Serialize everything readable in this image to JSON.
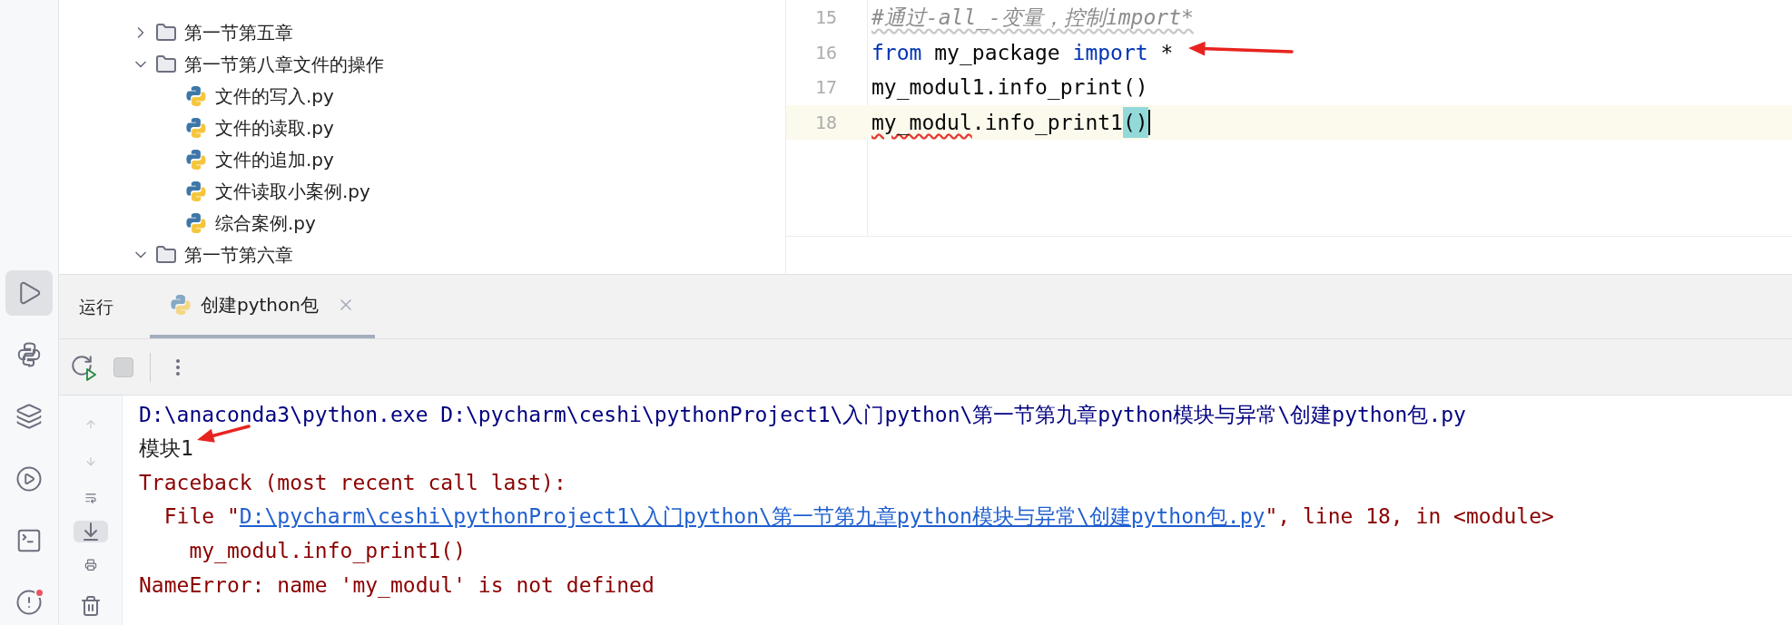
{
  "project_tree": {
    "items": [
      {
        "label": "第一节第五章",
        "kind": "folder",
        "expanded": false
      },
      {
        "label": "第一节第八章文件的操作",
        "kind": "folder",
        "expanded": true,
        "children": [
          {
            "label": "文件的写入.py",
            "kind": "file"
          },
          {
            "label": "文件的读取.py",
            "kind": "file"
          },
          {
            "label": "文件的追加.py",
            "kind": "file"
          },
          {
            "label": "文件读取小案例.py",
            "kind": "file"
          },
          {
            "label": "综合案例.py",
            "kind": "file"
          }
        ]
      },
      {
        "label": "第一节第六章",
        "kind": "folder",
        "expanded": true
      }
    ]
  },
  "editor": {
    "lines": [
      {
        "number": "15",
        "current": false,
        "tokens": [
          {
            "text": "#通过-all_-变量，控制import*",
            "kind": "comment"
          }
        ]
      },
      {
        "number": "16",
        "current": false,
        "tokens": [
          {
            "text": "from",
            "kind": "keyword"
          },
          {
            "text": " my_package ",
            "kind": "plain"
          },
          {
            "text": "import",
            "kind": "keyword"
          },
          {
            "text": " *",
            "kind": "plain"
          }
        ]
      },
      {
        "number": "17",
        "current": false,
        "tokens": [
          {
            "text": "my_modul1.info_print()",
            "kind": "plain"
          }
        ]
      },
      {
        "number": "18",
        "current": true,
        "tokens": [
          {
            "text": "my_modul",
            "kind": "error"
          },
          {
            "text": ".info_print1",
            "kind": "plain"
          },
          {
            "text": "()",
            "kind": "matched_brace"
          }
        ]
      }
    ]
  },
  "run_panel": {
    "title": "运行",
    "tabs": [
      {
        "label": "创建python包",
        "selected": true
      }
    ]
  },
  "console": {
    "lines": [
      {
        "segments": [
          {
            "text": "D:\\anaconda3\\python.exe D:\\pycharm\\ceshi\\pythonProject1\\入门python\\第一节第九章python模块与异常\\创建python包.py",
            "kind": "command"
          }
        ]
      },
      {
        "segments": [
          {
            "text": "模块1",
            "kind": "output"
          }
        ]
      },
      {
        "segments": [
          {
            "text": "Traceback (most recent call last):",
            "kind": "error"
          }
        ]
      },
      {
        "segments": [
          {
            "text": "  File \"",
            "kind": "error"
          },
          {
            "text": "D:\\pycharm\\ceshi\\pythonProject1\\入门python\\第一节第九章python模块与异常\\创建python包.py",
            "kind": "link"
          },
          {
            "text": "\", line 18, in <module>",
            "kind": "error"
          }
        ]
      },
      {
        "segments": [
          {
            "text": "    my_modul.info_print1()",
            "kind": "error"
          }
        ]
      },
      {
        "segments": [
          {
            "text": "NameError: name 'my_modul' is not defined",
            "kind": "error"
          }
        ]
      }
    ]
  }
}
